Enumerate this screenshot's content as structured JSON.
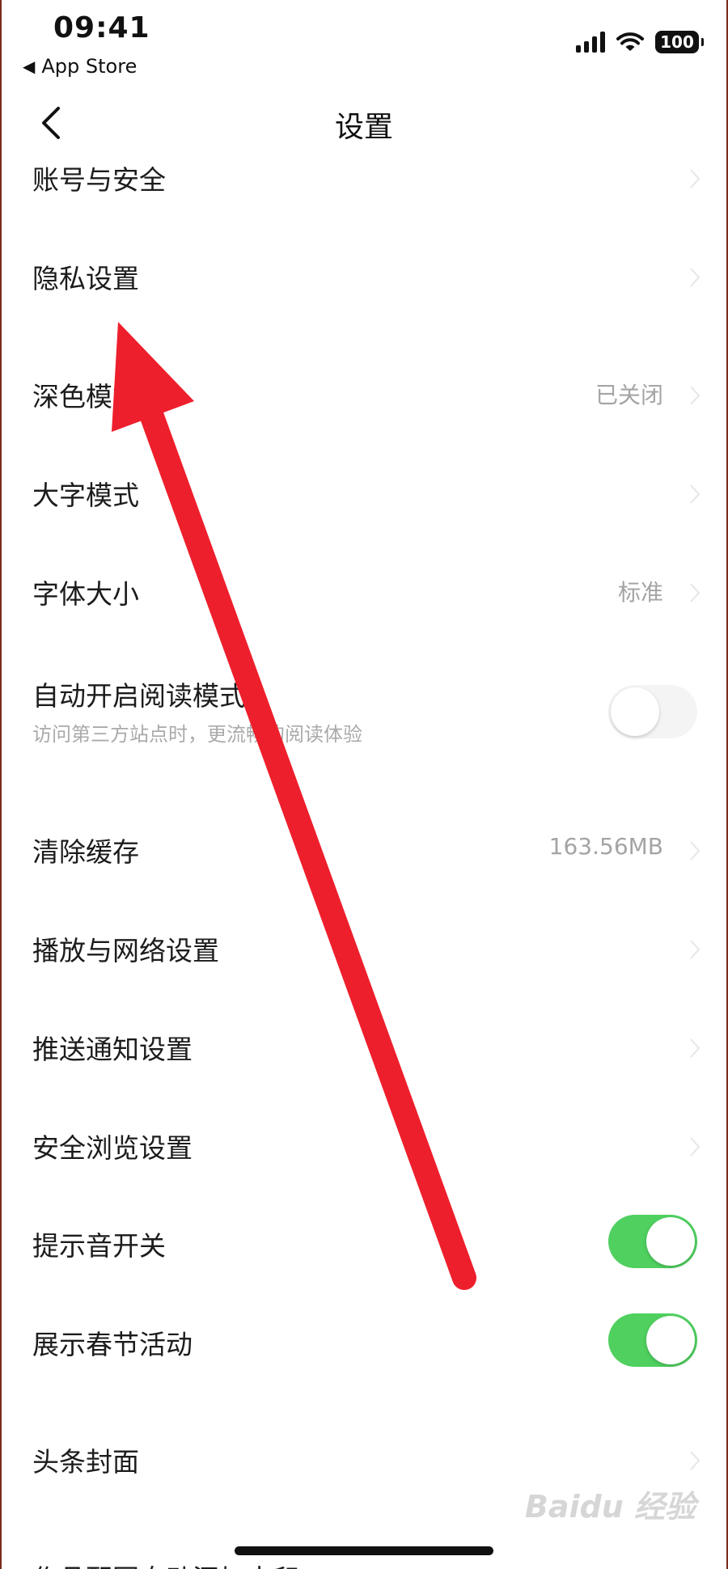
{
  "status_bar": {
    "time": "09:41",
    "back_app_label": "App Store",
    "battery": "100"
  },
  "nav": {
    "title": "设置"
  },
  "settings": {
    "account_security": {
      "label": "账号与安全"
    },
    "privacy": {
      "label": "隐私设置"
    },
    "dark_mode": {
      "label": "深色模式",
      "value": "已关闭"
    },
    "large_text": {
      "label": "大字模式"
    },
    "font_size": {
      "label": "字体大小",
      "value": "标准"
    },
    "reading_mode": {
      "label": "自动开启阅读模式",
      "sub": "访问第三方站点时，更流畅的阅读体验",
      "enabled": false
    },
    "clear_cache": {
      "label": "清除缓存",
      "value": "163.56MB"
    },
    "playback_network": {
      "label": "播放与网络设置"
    },
    "push_notifications": {
      "label": "推送通知设置"
    },
    "safe_browsing": {
      "label": "安全浏览设置"
    },
    "sound_toggle": {
      "label": "提示音开关",
      "enabled": true
    },
    "spring_festival": {
      "label": "展示春节活动",
      "enabled": true
    },
    "headline_cover": {
      "label": "头条封面"
    },
    "watermark_setting": {
      "label": "作品配图自动添加水印"
    }
  },
  "watermark": {
    "text": "Baidu 经验"
  },
  "colors": {
    "toggle_on": "#4fd05f",
    "annotation_arrow": "#ee1f2c",
    "secondary_text": "#a4a4a4"
  }
}
